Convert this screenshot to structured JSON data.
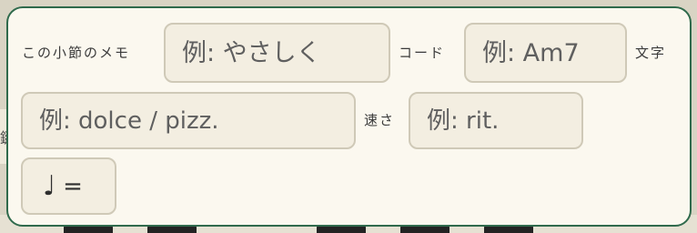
{
  "popup": {
    "measure_memo": {
      "label": "この小節のメモ",
      "placeholder": "例: やさしく"
    },
    "chord": {
      "label": "コード",
      "placeholder": "例: Am7"
    },
    "text": {
      "label": "文字",
      "placeholder": "例: dolce / pizz."
    },
    "speed": {
      "label": "速さ",
      "placeholder": "例: rit."
    },
    "tempo": {
      "note_symbol": "♩",
      "equals": "="
    }
  },
  "background": {
    "left_fragment_char": "鍵"
  }
}
